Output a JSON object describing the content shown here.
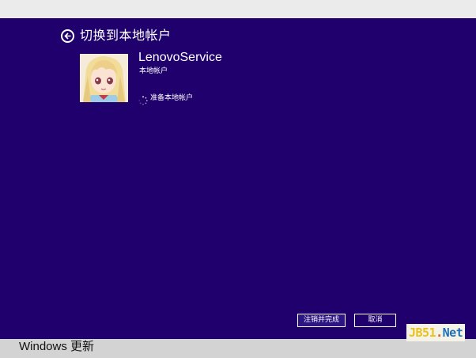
{
  "header": {
    "title": "切换到本地帐户"
  },
  "account": {
    "username": "LenovoService",
    "type": "本地帐户",
    "status": "准备本地帐户"
  },
  "buttons": {
    "finish": "注销并完成",
    "cancel": "取消"
  },
  "taskbar": {
    "label": "Windows 更新"
  },
  "watermark": {
    "jb": "JB51",
    "dot": ".",
    "net": "Net"
  },
  "colors": {
    "background": "#1f006c",
    "text": "#ffffff"
  },
  "icons": {
    "back": "back-arrow-circle-icon",
    "spinner": "loading-spinner-icon",
    "avatar": "anime-avatar"
  }
}
